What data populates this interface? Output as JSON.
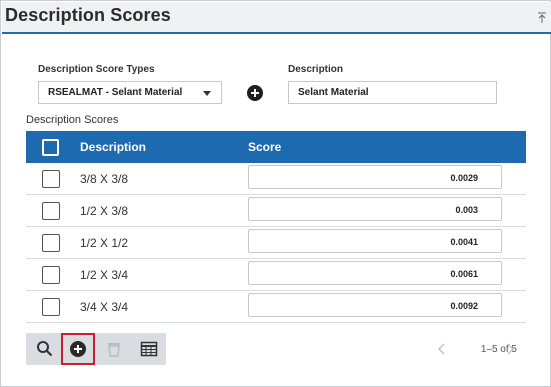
{
  "header": {
    "title": "Description Scores"
  },
  "form": {
    "type_label": "Description Score Types",
    "type_value": "RSEALMAT - Selant Material",
    "desc_label": "Description",
    "desc_value": "Selant Material"
  },
  "grid": {
    "section_label": "Description Scores",
    "columns": {
      "description": "Description",
      "score": "Score"
    },
    "rows": [
      {
        "description": "3/8 X 3/8",
        "score": "0.0029"
      },
      {
        "description": "1/2 X 3/8",
        "score": "0.003"
      },
      {
        "description": "1/2 X 1/2",
        "score": "0.0041"
      },
      {
        "description": "1/2 X 3/4",
        "score": "0.0061"
      },
      {
        "description": "3/4 X 3/4",
        "score": "0.0092"
      }
    ]
  },
  "pager": {
    "text": "1–5 of 5"
  },
  "colors": {
    "accent": "#1d6ab0",
    "highlight": "#c8202c",
    "toolbar": "#d9dde2"
  },
  "icons": [
    "collapse-icon",
    "plus-circle-icon",
    "search-icon",
    "trash-icon",
    "table-icon",
    "chevron-left-icon",
    "chevron-right-icon"
  ]
}
